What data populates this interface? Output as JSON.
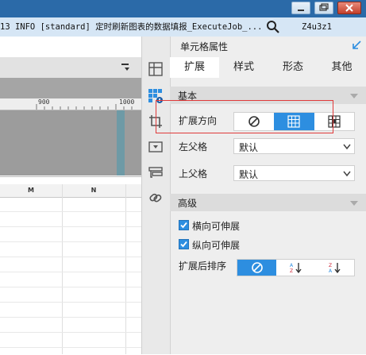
{
  "log": {
    "text": "13 INFO [standard] 定时刷新图表的数据填报_ExecuteJob_...",
    "id": "Z4u3z1"
  },
  "ruler": {
    "labels": [
      "900",
      "1000"
    ]
  },
  "grid": {
    "columns": [
      "M",
      "N"
    ]
  },
  "panel": {
    "title": "单元格属性",
    "tabs": [
      "扩展",
      "样式",
      "形态",
      "其他"
    ],
    "basic": {
      "header": "基本",
      "direction_label": "扩展方向",
      "left_parent_label": "左父格",
      "left_parent_value": "默认",
      "top_parent_label": "上父格",
      "top_parent_value": "默认"
    },
    "advanced": {
      "header": "高级",
      "horizontal_label": "横向可伸展",
      "vertical_label": "纵向可伸展",
      "sort_label": "扩展后排序"
    }
  },
  "colors": {
    "accent": "#2d8ee0",
    "highlight": "#e03a3a",
    "titlebar": "#2b6aa8"
  }
}
